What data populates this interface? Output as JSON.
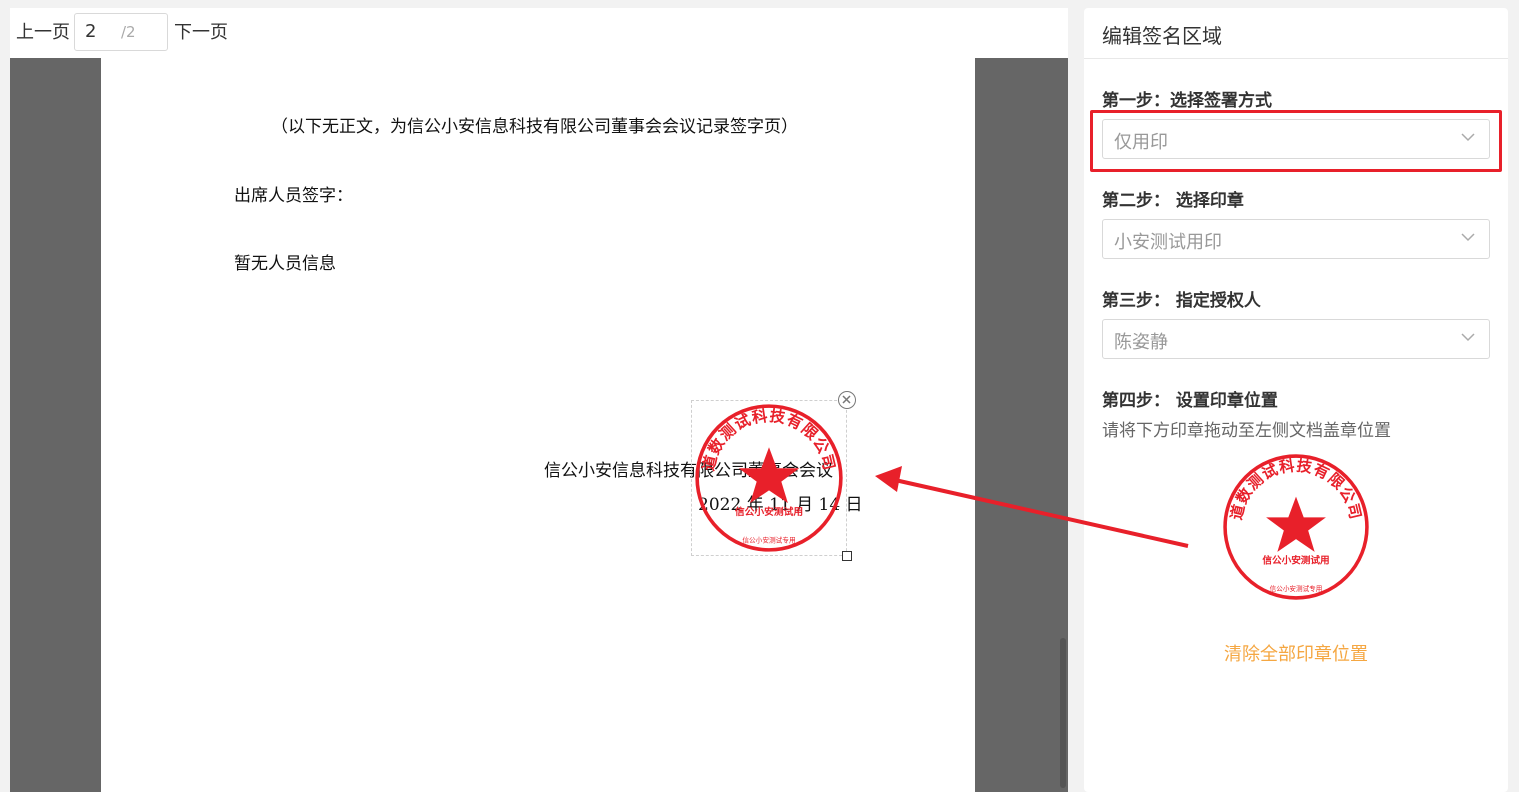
{
  "pager": {
    "prev_label": "上一页",
    "current_page": "2",
    "total_pages": "/2",
    "next_label": "下一页"
  },
  "document": {
    "lines": [
      "（以下无正文，为信公小安信息科技有限公司董事会会议记录签字页）",
      "出席人员签字：",
      "暂无人员信息",
      "信公小安信息科技有限公司董事会会议",
      "2022 年 11 月 14 日"
    ]
  },
  "seal": {
    "ring_text": "道数测试科技有限公司",
    "center_text": "信公小安测试用",
    "bottom_text": "信公小安测试专用",
    "color": "#e8202a"
  },
  "panel": {
    "title": "编辑签名区域",
    "step1_label": "第一步：选择签署方式",
    "step1_value": "仅用印",
    "step2_label": "第二步：  选择印章",
    "step2_value": "小安测试用印",
    "step3_label": "第三步：  指定授权人",
    "step3_value": "陈姿静",
    "step4_label": "第四步：  设置印章位置",
    "hint": "请将下方印章拖动至左侧文档盖章位置",
    "clear_label": "清除全部印章位置"
  },
  "colors": {
    "highlight": "#e8202a",
    "link_orange": "#f5a742",
    "viewer_bg": "#666666"
  }
}
